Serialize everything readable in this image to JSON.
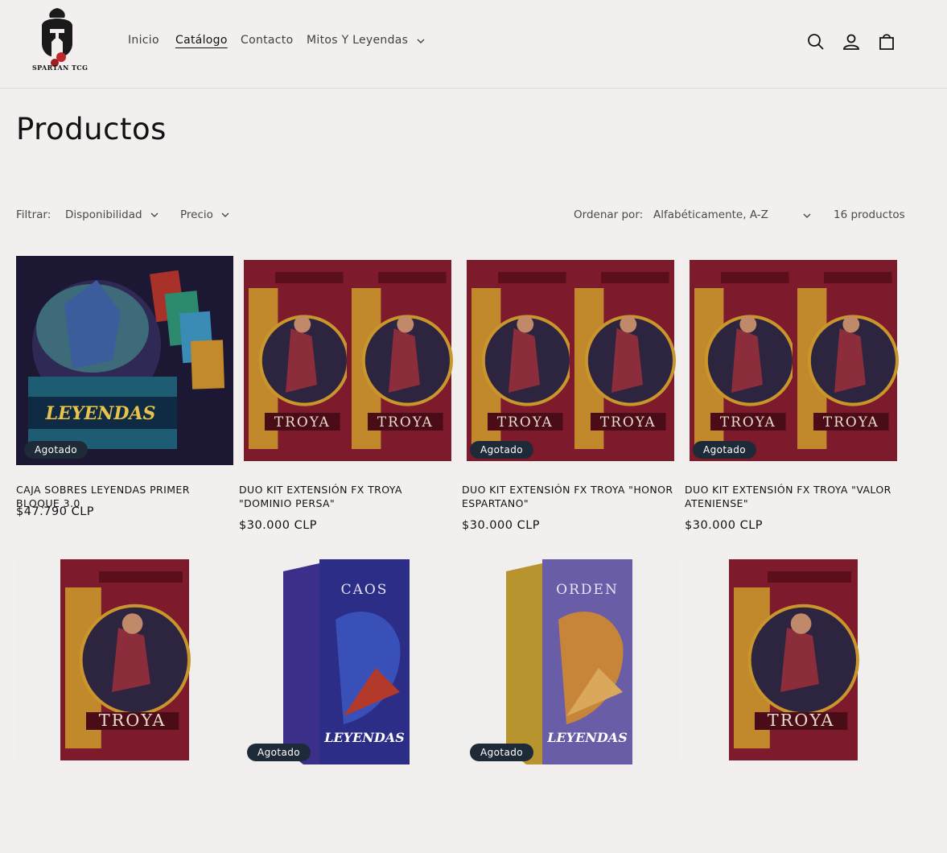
{
  "brand": {
    "logo_text": "SPARTAN TCG"
  },
  "nav": {
    "items": [
      {
        "label": "Inicio"
      },
      {
        "label": "Catálogo"
      },
      {
        "label": "Contacto"
      },
      {
        "label": "Mitos Y Leyendas"
      }
    ]
  },
  "header_icons": [
    "search-icon",
    "account-icon",
    "cart-icon"
  ],
  "page": {
    "title": "Productos"
  },
  "filters": {
    "label": "Filtrar:",
    "availability": "Disponibilidad",
    "price": "Precio",
    "sort_label": "Ordenar por:",
    "sort_value": "Alfabéticamente, A-Z",
    "count": "16 productos"
  },
  "products": [
    {
      "title": "CAJA SOBRES LEYENDAS PRIMER BLOQUE 3.0",
      "price": "$47.790 CLP",
      "badge": "Agotado",
      "art": "CAJA + SOBRES · LEYENDAS PRIMER BLOQUE"
    },
    {
      "title": "DUO KIT EXTENSIÓN FX TROYA \"DOMINIO PERSA\"",
      "price": "$30.000 CLP",
      "badge": "",
      "art": "KIT DE EXTENSIÓN · DOMINIO PERSA · TROYA"
    },
    {
      "title": "DUO KIT EXTENSIÓN FX TROYA \"HONOR ESPARTANO\"",
      "price": "$30.000 CLP",
      "badge": "Agotado",
      "art": "KIT DE EXTENSIÓN · HONOR ESPARTANO · TROYA"
    },
    {
      "title": "DUO KIT EXTENSIÓN FX TROYA \"VALOR ATENIENSE\"",
      "price": "$30.000 CLP",
      "badge": "Agotado",
      "art": "KIT DE EXTENSIÓN · VALOR ATENIENSE · TROYA"
    },
    {
      "title": "",
      "price": "",
      "badge": "",
      "art": "KIT DE EXTENSIÓN · VALOR ATENIENSE · TROYA"
    },
    {
      "title": "",
      "price": "",
      "badge": "Agotado",
      "art": "KIT DE BATALLA · CAOS · LEYENDAS PRIMER BLOQUE"
    },
    {
      "title": "",
      "price": "",
      "badge": "Agotado",
      "art": "KIT DE BATALLA · ORDEN · LEYENDAS PRIMER BLOQUE"
    },
    {
      "title": "",
      "price": "",
      "badge": "",
      "art": "KIT DE EXTENSIÓN · DOMINIO PERSA · TROYA"
    }
  ],
  "colors": {
    "background": "#f3efef",
    "badge": "#1f2a38",
    "troya_red": "#7d1a2b",
    "gold": "#c9962c"
  }
}
